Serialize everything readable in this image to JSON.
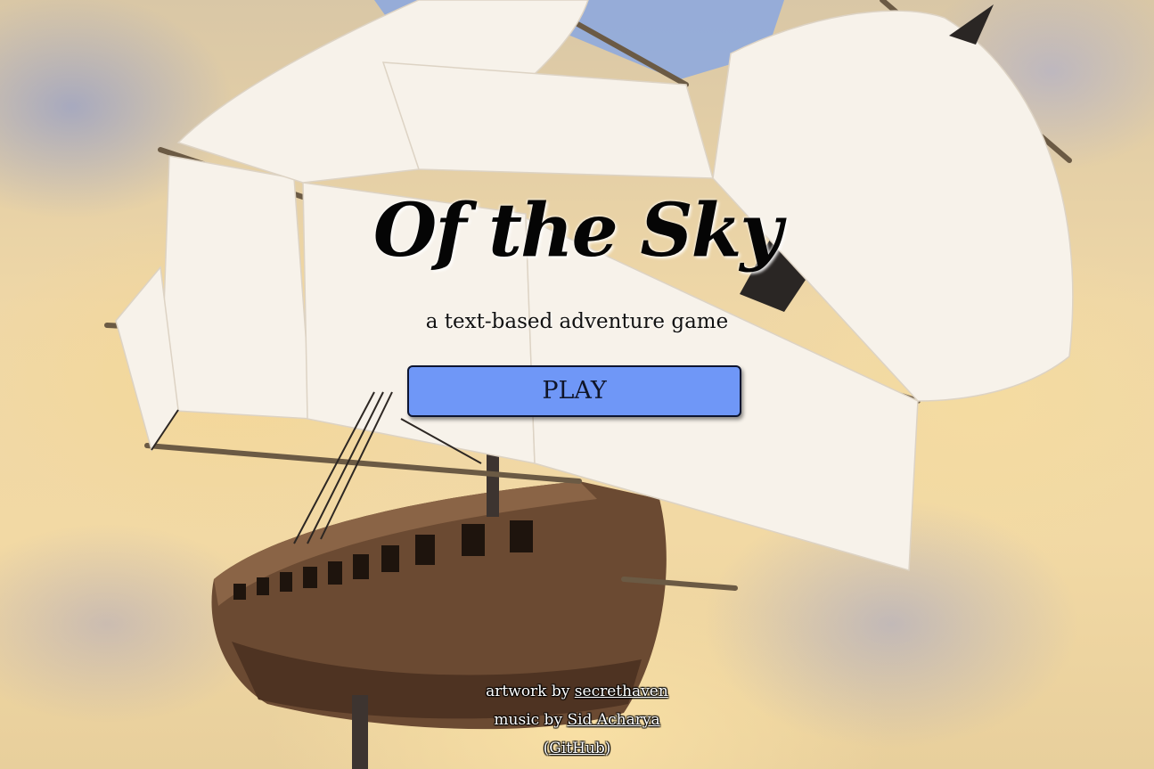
{
  "game": {
    "title": "Of the Sky",
    "subtitle": "a text-based adventure game",
    "play_label": "PLAY"
  },
  "credits": {
    "artwork_prefix": "artwork by",
    "artwork_author": "secrethaven",
    "music_prefix": "music by",
    "music_author": "Sid Acharya",
    "github_open": "(",
    "github_label": "GitHub",
    "github_close": ")"
  },
  "colors": {
    "play_button": "#6f97f7",
    "sails": "#f7f2ea",
    "hull": "#6b4a32",
    "sky": "#efd7a6"
  },
  "background": {
    "artwork": "flying-sailing-ship-in-clouds"
  }
}
